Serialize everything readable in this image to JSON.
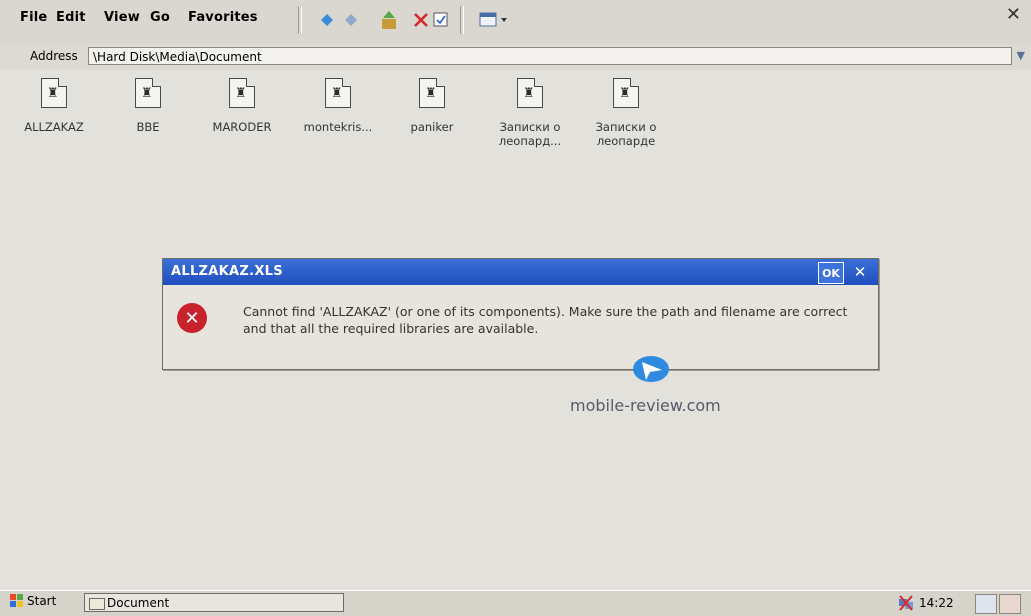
{
  "menubar": {
    "file_label": "File",
    "edit_label": "Edit",
    "view_label": "View",
    "go_label": "Go",
    "favorites_label": "Favorites"
  },
  "address": {
    "label": "Address",
    "path": "\\Hard Disk\\Media\\Document"
  },
  "files": [
    {
      "name": "ALLZAKAZ"
    },
    {
      "name": "BBE"
    },
    {
      "name": "MARODER"
    },
    {
      "name": "montekris..."
    },
    {
      "name": "paniker"
    },
    {
      "name": "Записки о леопард..."
    },
    {
      "name": "Записки о леопарде"
    }
  ],
  "dialog": {
    "title": "ALLZAKAZ.XLS",
    "ok_label": "OK",
    "message": "Cannot find 'ALLZAKAZ' (or one of its components). Make sure the path and filename are correct and that all the required libraries are available."
  },
  "watermark": {
    "text": "mobile-review.com"
  },
  "taskbar": {
    "start_label": "Start",
    "task_label": "Document",
    "time": "14:22"
  },
  "colors": {
    "title_bar": "#2b5fcf",
    "error_red": "#c8232c",
    "background": "#e2e1dc"
  }
}
